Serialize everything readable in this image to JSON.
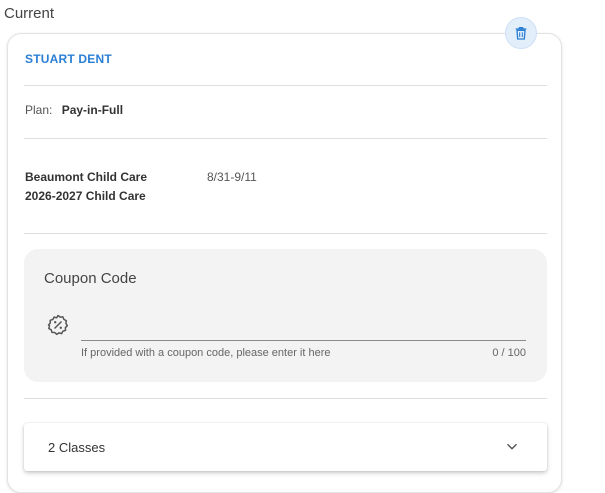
{
  "section": {
    "title": "Current"
  },
  "enrollment": {
    "student_name": "STUART DENT",
    "plan_label": "Plan:",
    "plan_value": "Pay-in-Full",
    "program_name_line1": "Beaumont Child Care",
    "program_name_line2": "2026-2027 Child Care",
    "date_range": "8/31-9/11",
    "delete_icon": "trash-icon"
  },
  "coupon": {
    "title": "Coupon Code",
    "icon": "coupon-percent-icon",
    "value": "",
    "hint": "If provided with a coupon code, please enter it here",
    "counter": "0 / 100"
  },
  "classes": {
    "label": "2 Classes",
    "icon": "chevron-down-icon"
  },
  "colors": {
    "accent": "#2a7fd4",
    "delete_bg": "#e3eefb",
    "coupon_bg": "#f3f3f3"
  }
}
